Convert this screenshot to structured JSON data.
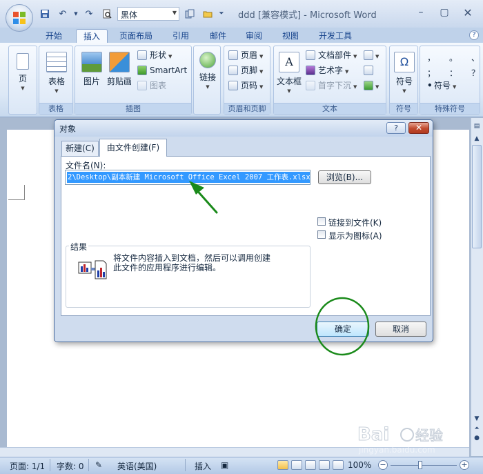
{
  "titlebar": {
    "font_name": "黑体",
    "document_title": "ddd [兼容模式] - Microsoft Word",
    "qat_icons": [
      "save-icon",
      "undo-icon",
      "redo-icon",
      "print-preview-icon"
    ]
  },
  "ribbon": {
    "tabs": [
      "开始",
      "插入",
      "页面布局",
      "引用",
      "邮件",
      "审阅",
      "视图",
      "开发工具"
    ],
    "active_tab": "插入",
    "groups": {
      "pages": {
        "button": "页"
      },
      "tables": {
        "button": "表格",
        "label": "表格"
      },
      "illustrations": {
        "picture": "图片",
        "clipart": "剪贴画",
        "shapes": "形状",
        "smartart": "SmartArt",
        "chart": "图表",
        "label": "插图"
      },
      "links": {
        "button": "链接"
      },
      "header_footer": {
        "header": "页眉",
        "footer": "页脚",
        "page_number": "页码",
        "label": "页眉和页脚"
      },
      "text": {
        "textbox": "文本框",
        "quickparts": "文档部件",
        "wordart": "艺术字",
        "dropcap": "首字下沉",
        "label": "文本"
      },
      "symbols": {
        "button": "符号",
        "label": "符号"
      },
      "special_symbols": {
        "row1": [
          "，",
          "。",
          "、"
        ],
        "row2": [
          "；",
          "：",
          "？"
        ],
        "more": "符号",
        "label": "特殊符号"
      }
    }
  },
  "dialog": {
    "title": "对象",
    "help": "?",
    "tabs": [
      "新建(C)",
      "由文件创建(F)"
    ],
    "filename_label": "文件名(N):",
    "filename_value": "2\\Desktop\\副本新建 Microsoft Office Excel 2007 工作表.xlsx",
    "browse_button": "浏览(B)...",
    "link_checkbox": "链接到文件(K)",
    "icon_checkbox": "显示为图标(A)",
    "result_label": "结果",
    "result_text_line1": "将文件内容插入到文档，然后可以调用创建",
    "result_text_line2": "此文件的应用程序进行编辑。",
    "ok_button": "确定",
    "cancel_button": "取消"
  },
  "statusbar": {
    "page": "页面: 1/1",
    "words": "字数: 0",
    "language": "英语(美国)",
    "mode": "插入",
    "zoom": "100%"
  },
  "colors": {
    "annotation": "#1a8a1a",
    "selection": "#3399ff",
    "close_button": "#c04a2e"
  }
}
